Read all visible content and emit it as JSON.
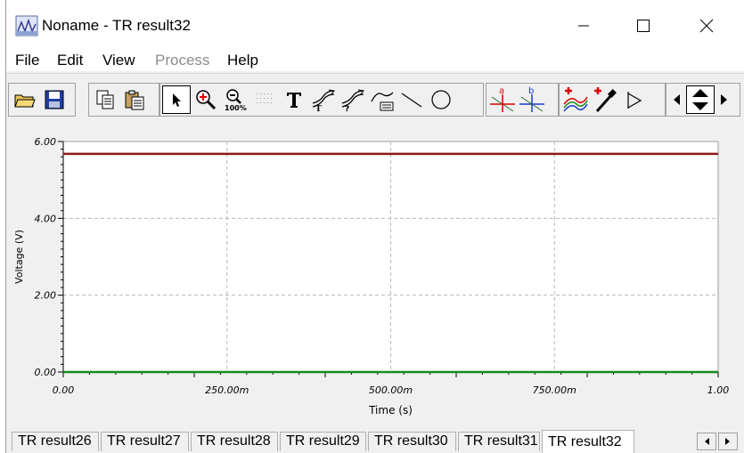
{
  "window": {
    "title": "Noname - TR result32"
  },
  "menu": {
    "file": "File",
    "edit": "Edit",
    "view": "View",
    "process": "Process",
    "help": "Help"
  },
  "toolbar": {
    "icons": [
      "open-folder-icon",
      "save-disk-icon",
      "copy-icon",
      "paste-icon",
      "select-arrow-icon",
      "zoom-in-icon",
      "zoom-100-icon",
      "grid-icon",
      "text-tool-icon",
      "curve-label-icon",
      "curve-query-icon",
      "curve-table-icon",
      "line-tool-icon",
      "circle-tool-icon",
      "cursor-a-icon",
      "cursor-b-icon",
      "add-curve-icon",
      "eyedropper-icon",
      "flag-icon",
      "arrow-left-icon",
      "arrow-up-down-icon",
      "arrow-right-icon"
    ],
    "zoom_label": "100%"
  },
  "chart_data": {
    "type": "line",
    "xlabel": "Time (s)",
    "ylabel": "Voltage (V)",
    "xlim": [
      0,
      1
    ],
    "ylim": [
      0,
      6
    ],
    "x_ticks": [
      {
        "value": 0,
        "label": "0.00"
      },
      {
        "value": 0.25,
        "label": "250.00m"
      },
      {
        "value": 0.5,
        "label": "500.00m"
      },
      {
        "value": 0.75,
        "label": "750.00m"
      },
      {
        "value": 1,
        "label": "1.00"
      }
    ],
    "y_ticks": [
      {
        "value": 0,
        "label": "0.00"
      },
      {
        "value": 2,
        "label": "2.00"
      },
      {
        "value": 4,
        "label": "4.00"
      },
      {
        "value": 6,
        "label": "6.00"
      }
    ],
    "grid": true,
    "series": [
      {
        "color": "#8b1a1a",
        "x": [
          0,
          1
        ],
        "y": [
          5.68,
          5.68
        ]
      },
      {
        "color": "#1a8a1a",
        "x": [
          0,
          1
        ],
        "y": [
          0.0,
          0.0
        ]
      }
    ]
  },
  "tabs": [
    "TR result26",
    "TR result27",
    "TR result28",
    "TR result29",
    "TR result30",
    "TR result31",
    "TR result32"
  ],
  "active_tab": "TR result32"
}
